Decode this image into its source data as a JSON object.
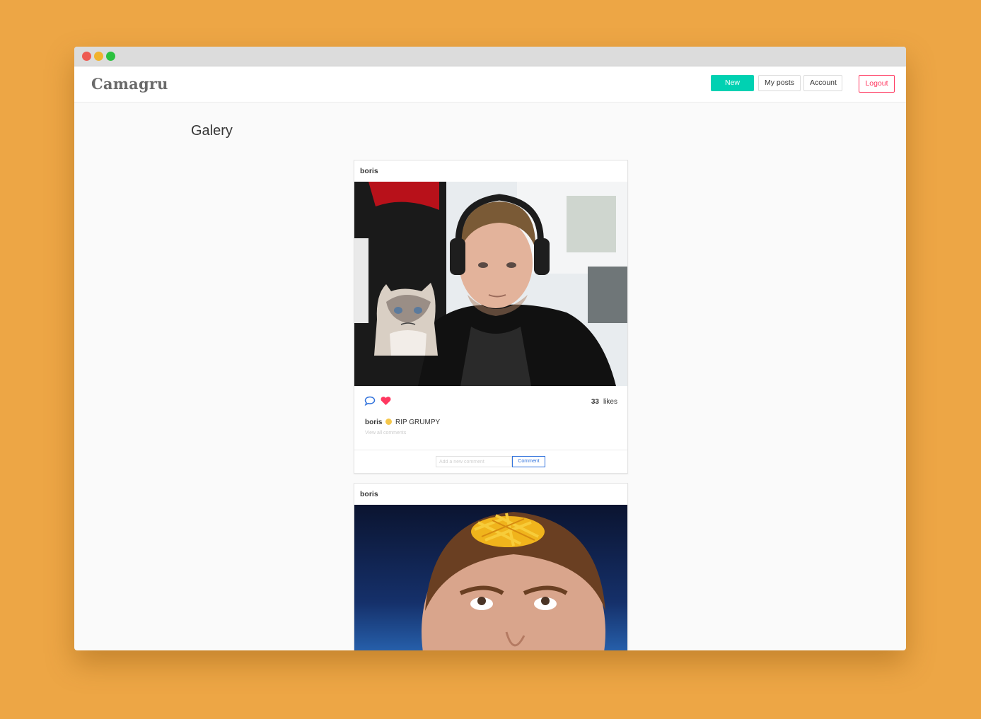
{
  "window": {
    "controls": [
      "close",
      "minimize",
      "maximize"
    ]
  },
  "navbar": {
    "brand": "Camagru",
    "new_post": "New post",
    "my_posts": "My posts",
    "account": "Account",
    "logout": "Logout"
  },
  "page": {
    "title": "Galery"
  },
  "posts": [
    {
      "user": "boris",
      "image": "webcam selfie with grumpy cat sticker",
      "likes_count": "33",
      "likes_label": "likes",
      "caption_author": "boris",
      "caption_text": "RIP GRUMPY",
      "view_all": "View all comments",
      "comment_placeholder": "Add a new comment",
      "comment_button": "Comment"
    },
    {
      "user": "boris",
      "image": "man looking up with french fries sticker on forehead"
    }
  ],
  "colors": {
    "background": "#eda645",
    "primary": "#00d1b2",
    "danger": "#ff3860",
    "link": "#3273dc",
    "heart": "#ff3860"
  }
}
